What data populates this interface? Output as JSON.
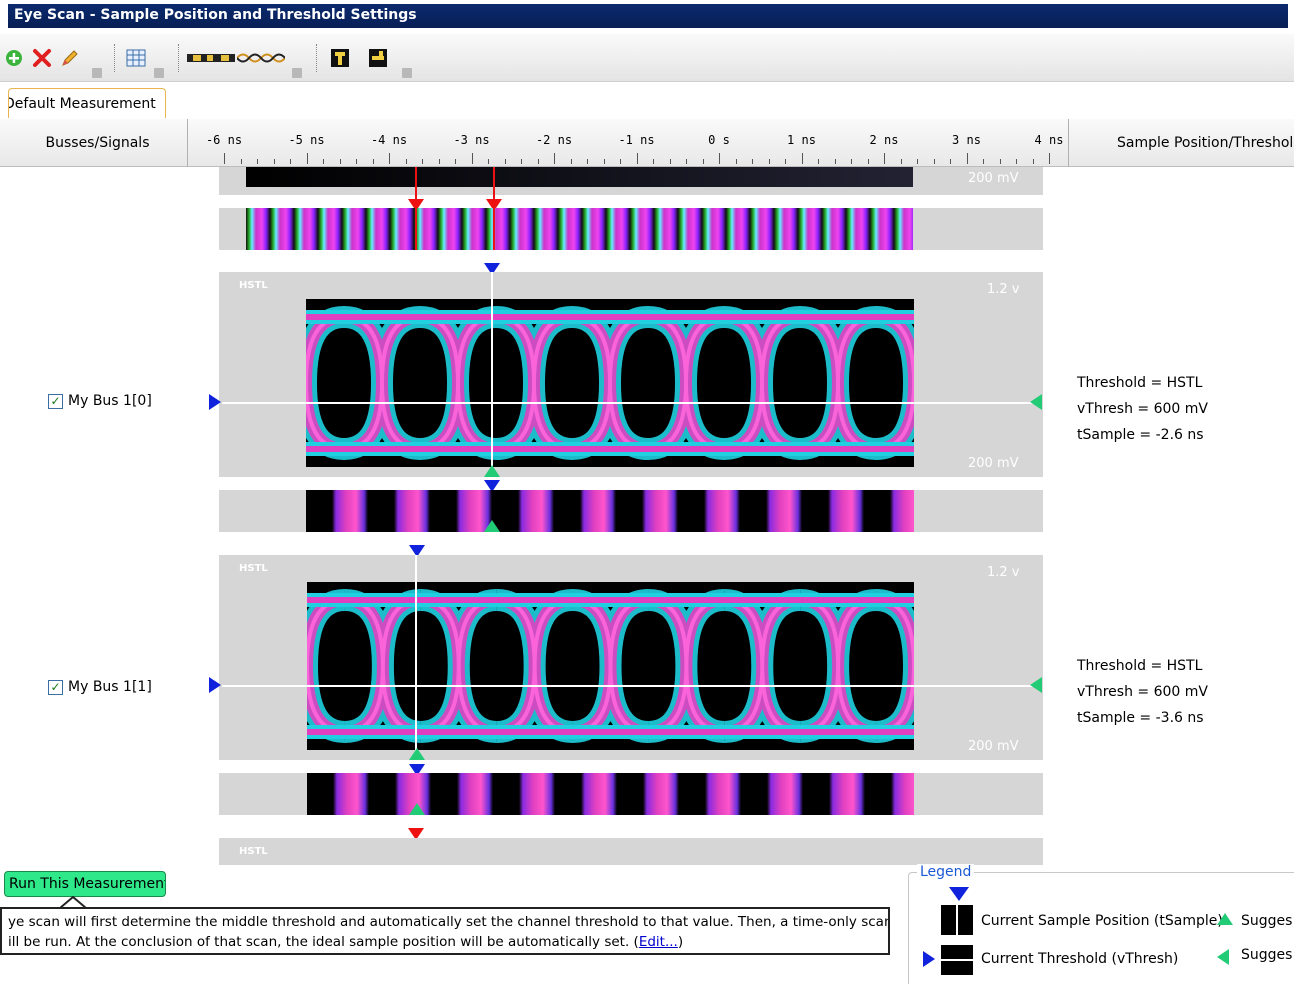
{
  "window": {
    "title": "Eye Scan - Sample Position and Threshold Settings"
  },
  "toolbar": {
    "buttons": [
      {
        "name": "add",
        "icon": "plus-circle-icon"
      },
      {
        "name": "delete",
        "icon": "red-x-icon"
      },
      {
        "name": "edit",
        "icon": "pencil-icon"
      },
      {
        "name": "table",
        "icon": "table-icon"
      },
      {
        "name": "bus-view",
        "icon": "bus-waveform-icon"
      },
      {
        "name": "eye-view",
        "icon": "eye-diagram-icon"
      },
      {
        "name": "sample-marker",
        "icon": "sample-marker-icon"
      },
      {
        "name": "threshold-marker",
        "icon": "threshold-marker-icon"
      }
    ]
  },
  "tabs": [
    {
      "label": "Default Measurement",
      "active": true
    }
  ],
  "header": {
    "left_column": "Busses/Signals",
    "right_column": "Sample Position/Threshold",
    "time_ticks": [
      "-6 ns",
      "-5 ns",
      "-4 ns",
      "-3 ns",
      "-2 ns",
      "-1 ns",
      "0 s",
      "1 ns",
      "2 ns",
      "3 ns",
      "4 ns"
    ]
  },
  "signals": [
    {
      "label": "My Bus 1[0]",
      "checked": true,
      "standard": "HSTL",
      "scale_top": "1.2 v",
      "scale_bottom": "200 mV",
      "info": {
        "threshold": "Threshold = HSTL",
        "vthresh": "vThresh = 600 mV",
        "tsample": "tSample = -2.6 ns"
      }
    },
    {
      "label": "My Bus 1[1]",
      "checked": true,
      "standard": "HSTL",
      "scale_top": "1.2 v",
      "scale_bottom": "200 mV",
      "info": {
        "threshold": "Threshold = HSTL",
        "vthresh": "vThresh = 600 mV",
        "tsample": "tSample = -3.6 ns"
      }
    }
  ],
  "partial_rows": {
    "top_scale_bottom": "200 mV",
    "bottom_standard": "HSTL"
  },
  "run_button": {
    "label": "Run This Measurement"
  },
  "description": {
    "line1": "ye scan will first determine the middle threshold and automatically set the channel threshold to that value. Then, a time-only scan",
    "line2": "ill be run. At the conclusion of that scan, the ideal sample position will be automatically set. (",
    "link": "Edit...",
    "line2_end": ")"
  },
  "legend": {
    "title": "Legend",
    "items": [
      {
        "label": "Current Sample Position (tSample)"
      },
      {
        "label": "Current Threshold (vThresh)"
      },
      {
        "label": "Sugges"
      },
      {
        "label": "Sugges"
      }
    ]
  },
  "colors": {
    "title_bar": "#0a2a6e",
    "run_button": "#2ee88a",
    "marker_blue": "#1122dd",
    "marker_green": "#22cc77",
    "marker_red": "#ee1111",
    "eye_magenta": "#e040c0",
    "eye_cyan": "#20d0e0",
    "link": "#0000cc"
  }
}
